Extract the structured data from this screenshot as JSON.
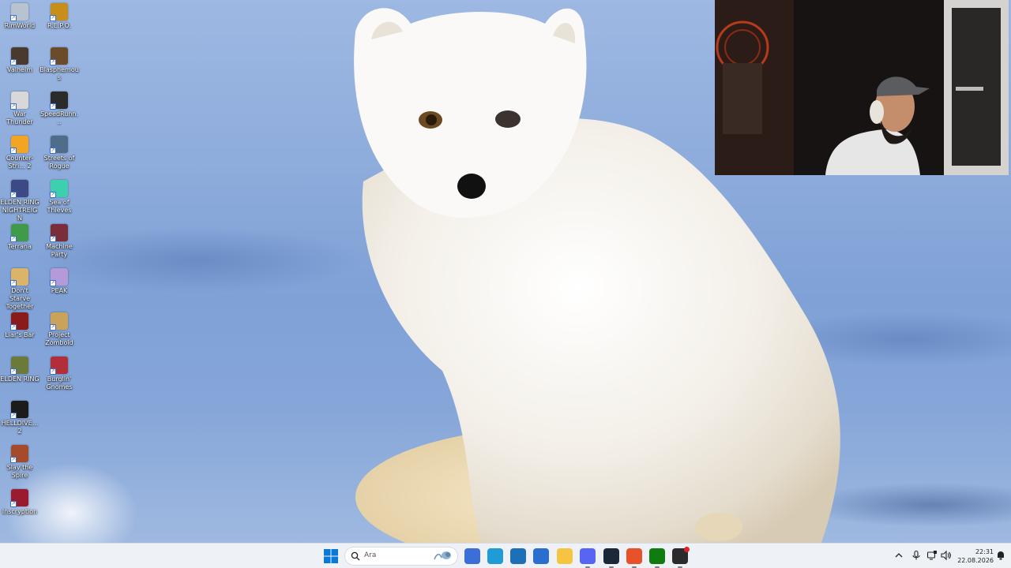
{
  "desktop": {
    "icons": [
      {
        "label": "RimWorld",
        "icon": "rimworld-icon",
        "color": "#b9c3cf"
      },
      {
        "label": "R.E.P.O.",
        "icon": "repo-icon",
        "color": "#c78e1c"
      },
      {
        "label": "Valheim",
        "icon": "valheim-icon",
        "color": "#4a3a2e"
      },
      {
        "label": "Blasphemous",
        "icon": "blasphemous-icon",
        "color": "#6b4b2a"
      },
      {
        "label": "War Thunder",
        "icon": "war-thunder-icon",
        "color": "#d8d8d8"
      },
      {
        "label": "SpeedRunn...",
        "icon": "speedrunners-icon",
        "color": "#2b2b2b"
      },
      {
        "label": "Counter-Stri... 2",
        "icon": "counter-strike-icon",
        "color": "#f2a523"
      },
      {
        "label": "Streets of Rogue",
        "icon": "streets-of-rogue-icon",
        "color": "#4f6d8a"
      },
      {
        "label": "ELDEN RING NIGHTREIGN",
        "icon": "elden-ring-nightreign-icon",
        "color": "#3b4a86"
      },
      {
        "label": "Sea of Thieves",
        "icon": "sea-of-thieves-icon",
        "color": "#3ccfb0"
      },
      {
        "label": "Terrana",
        "icon": "terrana-icon",
        "color": "#3f9a4a"
      },
      {
        "label": "Machine Party",
        "icon": "machine-party-icon",
        "color": "#7a2e3a"
      },
      {
        "label": "Don't Starve Together",
        "icon": "dont-starve-together-icon",
        "color": "#d9b46a"
      },
      {
        "label": "PEAK",
        "icon": "peak-icon",
        "color": "#b49ad9"
      },
      {
        "label": "Liar's Bar",
        "icon": "liars-bar-icon",
        "color": "#8a1b1b"
      },
      {
        "label": "Project Zomboid",
        "icon": "project-zomboid-icon",
        "color": "#c9a35a"
      },
      {
        "label": "ELDEN RING",
        "icon": "elden-ring-icon",
        "color": "#6b7a3a"
      },
      {
        "label": "Burglin' Gnomes",
        "icon": "burglin-gnomes-icon",
        "color": "#b22e3a"
      },
      {
        "label": "HELLDIVE... 2",
        "icon": "helldivers-icon",
        "color": "#1b1b1b"
      },
      {
        "label": "Slay the Spire",
        "icon": "slay-the-spire-icon",
        "color": "#a54a2a"
      },
      {
        "label": "Inscryption",
        "icon": "inscryption-icon",
        "color": "#9b1b2e"
      }
    ]
  },
  "webcam": {
    "icon": "webcam-overlay"
  },
  "taskbar": {
    "start_icon": "windows-start-icon",
    "search_placeholder": "Ara",
    "apps": [
      {
        "name": "widgets-icon",
        "color": "#3b6fd6"
      },
      {
        "name": "edge-icon",
        "color": "#1f9bd6"
      },
      {
        "name": "microsoft-store-icon",
        "color": "#1d6fb8"
      },
      {
        "name": "outlook-icon",
        "color": "#2a6fd0"
      },
      {
        "name": "file-explorer-icon",
        "color": "#f5c542"
      },
      {
        "name": "discord-icon",
        "color": "#5865f2"
      },
      {
        "name": "steam-icon",
        "color": "#1b2838"
      },
      {
        "name": "firefox-icon",
        "color": "#e8522b"
      },
      {
        "name": "xbox-icon",
        "color": "#107c10"
      },
      {
        "name": "app-with-badge-icon",
        "color": "#2b2b2b"
      }
    ],
    "tray": {
      "chevron_icon": "chevron-up-icon",
      "mic_icon": "microphone-icon",
      "network_icon": "network-icon",
      "volume_icon": "volume-icon",
      "notification_icon": "notification-icon"
    },
    "clock": {
      "time": "22:31",
      "date": "22.08.2026"
    }
  }
}
